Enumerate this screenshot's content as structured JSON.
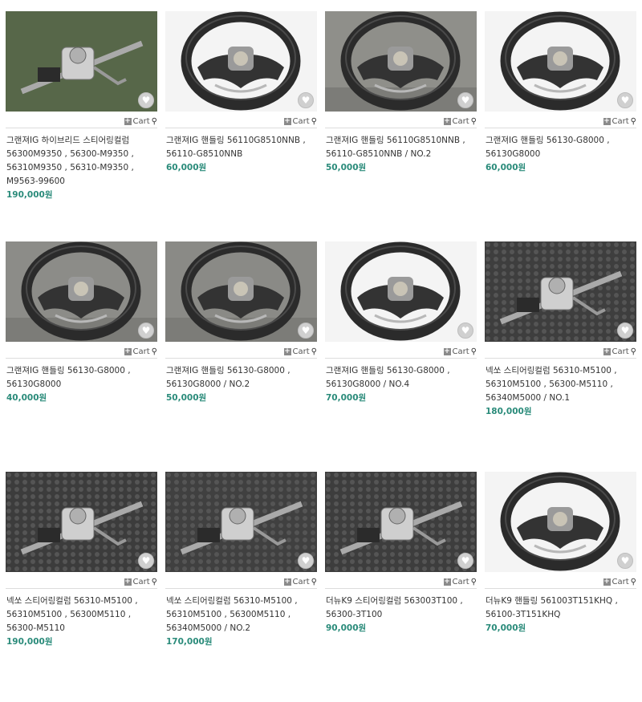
{
  "products": [
    {
      "name": "그랜져IG 하이브리드 스티어링컬럼 56300M9350 , 56300-M9350 , 56310M9350 , 56310-M9350 , M9563-99600",
      "price": "190,000원",
      "cart_label": "Cart",
      "image": "steering-column",
      "bg": "#5a6a4c"
    },
    {
      "name": "그랜져IG 핸들링 56110G8510NNB , 56110-G8510NNB",
      "price": "60,000원",
      "cart_label": "Cart",
      "image": "steering-wheel",
      "bg": "#f4f4f4"
    },
    {
      "name": "그랜져IG 핸들링 56110G8510NNB , 56110-G8510NNB / NO.2",
      "price": "50,000원",
      "cart_label": "Cart",
      "image": "steering-wheel",
      "bg": "#8f8f8a"
    },
    {
      "name": "그랜져IG 핸들링 56130-G8000 , 56130G8000",
      "price": "60,000원",
      "cart_label": "Cart",
      "image": "steering-wheel",
      "bg": "#f4f4f4"
    },
    {
      "name": "그랜져IG 핸들링 56130-G8000 , 56130G8000",
      "price": "40,000원",
      "cart_label": "Cart",
      "image": "steering-wheel",
      "bg": "#8c8c88"
    },
    {
      "name": "그랜져IG 핸들링 56130-G8000 , 56130G8000 / NO.2",
      "price": "50,000원",
      "cart_label": "Cart",
      "image": "steering-wheel",
      "bg": "#8a8a86"
    },
    {
      "name": "그랜져IG 핸들링 56130-G8000 , 56130G8000 / NO.4",
      "price": "70,000원",
      "cart_label": "Cart",
      "image": "steering-wheel",
      "bg": "#f4f4f4"
    },
    {
      "name": "넥쏘 스티어링컬럼 56310-M5100 , 56310M5100 , 56300-M5110 , 56340M5000 / NO.1",
      "price": "180,000원",
      "cart_label": "Cart",
      "image": "steering-column-foam",
      "bg": "#3e3e3e"
    },
    {
      "name": "넥쏘 스티어링컬럼 56310-M5100 , 56310M5100 , 56300M5110 , 56300-M5110",
      "price": "190,000원",
      "cart_label": "Cart",
      "image": "steering-column-foam",
      "bg": "#3c3c3c"
    },
    {
      "name": "넥쏘 스티어링컬럼 56310-M5100 , 56310M5100 , 56300M5110 , 56340M5000 / NO.2",
      "price": "170,000원",
      "cart_label": "Cart",
      "image": "steering-column-foam",
      "bg": "#404040"
    },
    {
      "name": "더뉴K9 스티어링컬럼 563003T100 , 56300-3T100",
      "price": "90,000원",
      "cart_label": "Cart",
      "image": "steering-column-foam",
      "bg": "#3d3d3d"
    },
    {
      "name": "더뉴K9 핸들링 561003T151KHQ , 56100-3T151KHQ",
      "price": "70,000원",
      "cart_label": "Cart",
      "image": "steering-wheel",
      "bg": "#f4f4f4"
    }
  ],
  "icons": {
    "heart": "heart-icon",
    "cart_plus": "plus-icon",
    "cart_search": "magnifier-icon"
  },
  "colors": {
    "price": "#2a8b7a",
    "text": "#333333",
    "divider": "#dcdcdc"
  }
}
